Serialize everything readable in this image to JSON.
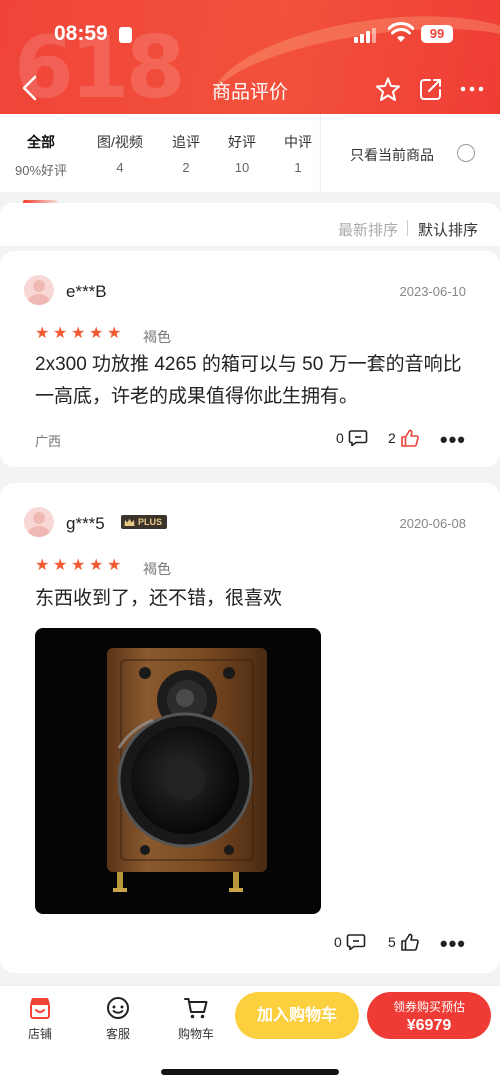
{
  "status": {
    "time": "08:59",
    "battery": "99"
  },
  "header": {
    "title": "商品评价",
    "watermark": "618"
  },
  "tabs": [
    {
      "label": "全部",
      "count": "90%好评"
    },
    {
      "label": "图/视频",
      "count": "4"
    },
    {
      "label": "追评",
      "count": "2"
    },
    {
      "label": "好评",
      "count": "10"
    },
    {
      "label": "中评",
      "count": "1"
    }
  ],
  "filter": {
    "only_current_label": "只看当前商品"
  },
  "sort": {
    "latest": "最新排序",
    "default": "默认排序"
  },
  "reviews": [
    {
      "user": "e***B",
      "date": "2023-06-10",
      "stars": 5,
      "variant": "褐色",
      "text": "2x300 功放推 4265 的箱可以与 50 万一套的音响比一高底，许老的成果值得你此生拥有。",
      "region": "广西",
      "comments": "0",
      "likes": "2"
    },
    {
      "user": "g***5",
      "badge": "PLUS",
      "date": "2020-06-08",
      "stars": 5,
      "variant": "褐色",
      "text": "东西收到了，还不错，很喜欢",
      "comments": "0",
      "likes": "5"
    }
  ],
  "bottom": {
    "shop": "店铺",
    "service": "客服",
    "cart": "购物车",
    "add_cart": "加入购物车",
    "buy_line1": "领券购买预估",
    "buy_price": "¥6979"
  },
  "colors": {
    "brand_red": "#f0443a",
    "star": "#ef5a32",
    "cart_yellow": "#fbcf3e"
  }
}
